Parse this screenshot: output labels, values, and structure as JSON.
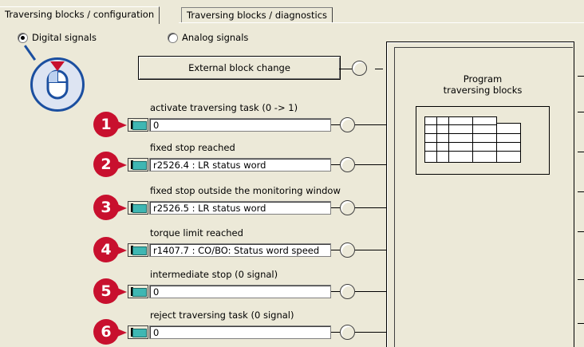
{
  "tabs": [
    {
      "label": "Traversing blocks / configuration",
      "active": true
    },
    {
      "label": "Traversing blocks / diagnostics",
      "active": false
    }
  ],
  "signal_type": {
    "digital_label": "Digital signals",
    "analog_label": "Analog signals",
    "selected": "Digital signals"
  },
  "external_block_change": {
    "label": "External block change"
  },
  "program": {
    "title_line1": "Program",
    "title_line2": "traversing blocks"
  },
  "signals": [
    {
      "badge": "1",
      "label": "activate traversing task (0 -> 1)",
      "value": "0"
    },
    {
      "badge": "2",
      "label": "fixed stop reached",
      "value": "r2526.4 : LR status word"
    },
    {
      "badge": "3",
      "label": "fixed stop outside the monitoring window",
      "value": "r2526.5 : LR status word"
    },
    {
      "badge": "4",
      "label": "torque limit reached",
      "value": "r1407.7 : CO/BO: Status word speed"
    },
    {
      "badge": "5",
      "label": "intermediate stop (0 signal)",
      "value": "0"
    },
    {
      "badge": "6",
      "label": "reject traversing task (0 signal)",
      "value": "0"
    }
  ],
  "icons": {
    "signal_button": "signal-source-icon",
    "node": "connector-node-icon",
    "mouse": "mouse-click-icon",
    "grid": "traversing-table-icon"
  },
  "colors": {
    "badge": "#c8102e",
    "signal_button": "#3fb7b3",
    "mouse_outline": "#1b4fa0"
  }
}
